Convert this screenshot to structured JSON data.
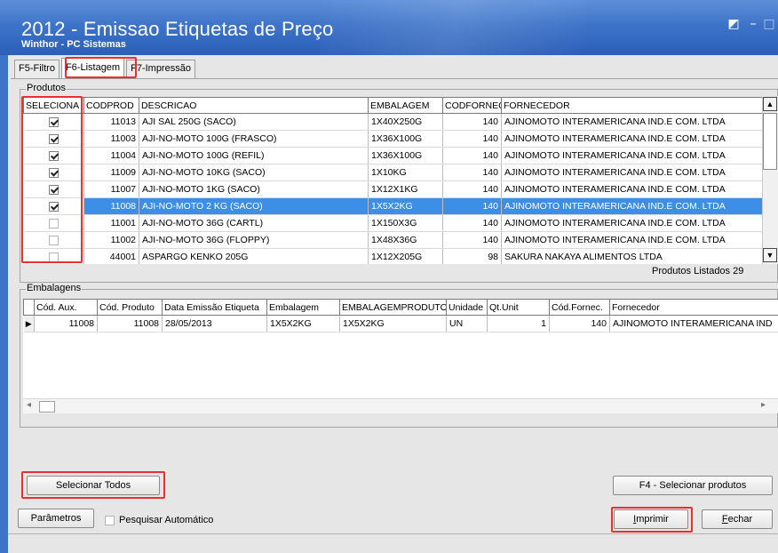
{
  "window": {
    "title": "2012 - Emissao Etiquetas de Preço",
    "subtitle": "Winthor - PC Sistemas"
  },
  "tabs": [
    {
      "label": "F5-Filtro"
    },
    {
      "label": "F6-Listagem"
    },
    {
      "label": "F7-Impressão"
    }
  ],
  "produtos": {
    "group_label": "Produtos",
    "columns": [
      "SELECIONA",
      "CODPROD",
      "DESCRICAO",
      "EMBALAGEM",
      "CODFORNEC",
      "FORNECEDOR"
    ],
    "rows": [
      {
        "checked": true,
        "codprod": "11013",
        "descricao": "AJI SAL 250G (SACO)",
        "embalagem": "1X40X250G",
        "codfornec": "140",
        "fornecedor": "AJINOMOTO INTERAMERICANA IND.E COM. LTDA"
      },
      {
        "checked": true,
        "codprod": "11003",
        "descricao": "AJI-NO-MOTO 100G (FRASCO)",
        "embalagem": "1X36X100G",
        "codfornec": "140",
        "fornecedor": "AJINOMOTO INTERAMERICANA IND.E COM. LTDA"
      },
      {
        "checked": true,
        "codprod": "11004",
        "descricao": "AJI-NO-MOTO 100G (REFIL)",
        "embalagem": "1X36X100G",
        "codfornec": "140",
        "fornecedor": "AJINOMOTO INTERAMERICANA IND.E COM. LTDA"
      },
      {
        "checked": true,
        "codprod": "11009",
        "descricao": "AJI-NO-MOTO 10KG (SACO)",
        "embalagem": "1X10KG",
        "codfornec": "140",
        "fornecedor": "AJINOMOTO INTERAMERICANA IND.E COM. LTDA"
      },
      {
        "checked": true,
        "codprod": "11007",
        "descricao": "AJI-NO-MOTO 1KG (SACO)",
        "embalagem": "1X12X1KG",
        "codfornec": "140",
        "fornecedor": "AJINOMOTO INTERAMERICANA IND.E COM. LTDA"
      },
      {
        "checked": true,
        "codprod": "11008",
        "descricao": "AJI-NO-MOTO 2 KG (SACO)",
        "embalagem": "1X5X2KG",
        "codfornec": "140",
        "fornecedor": "AJINOMOTO INTERAMERICANA IND.E COM. LTDA",
        "selected": true
      },
      {
        "checked": false,
        "codprod": "11001",
        "descricao": "AJI-NO-MOTO 36G (CARTL)",
        "embalagem": "1X150X3G",
        "codfornec": "140",
        "fornecedor": "AJINOMOTO INTERAMERICANA IND.E COM. LTDA"
      },
      {
        "checked": false,
        "codprod": "11002",
        "descricao": "AJI-NO-MOTO 36G (FLOPPY)",
        "embalagem": "1X48X36G",
        "codfornec": "140",
        "fornecedor": "AJINOMOTO INTERAMERICANA IND.E COM. LTDA"
      },
      {
        "checked": false,
        "codprod": "44001",
        "descricao": "ASPARGO KENKO 205G",
        "embalagem": "1X12X205G",
        "codfornec": "98",
        "fornecedor": "SAKURA NAKAYA ALIMENTOS LTDA"
      }
    ],
    "status": "Produtos Listados 29"
  },
  "embalagens": {
    "group_label": "Embalagens",
    "columns": [
      "Cód. Aux.",
      "Cód. Produto",
      "Data Emissão Etiqueta",
      "Embalagem",
      "EMBALAGEMPRODUTO",
      "Unidade",
      "Qt.Unit",
      "Cód.Fornec.",
      "Fornecedor"
    ],
    "rows": [
      {
        "cod_aux": "11008",
        "cod_produto": "11008",
        "data_emissao": "28/05/2013",
        "embalagem": "1X5X2KG",
        "embalagemproduto": "1X5X2KG",
        "unidade": "UN",
        "qt_unit": "1",
        "cod_fornec": "140",
        "fornecedor": "AJINOMOTO INTERAMERICANA IND"
      }
    ]
  },
  "buttons": {
    "selecionar_todos": "Selecionar Todos",
    "f4_selecionar": "F4 - Selecionar produtos",
    "parametros": "Parâmetros",
    "imprimir_first": "I",
    "imprimir_rest": "mprimir",
    "fechar_first": "F",
    "fechar_rest": "echar"
  },
  "pesquisar_automatico": {
    "label": "Pesquisar Automático",
    "checked": false
  },
  "colors": {
    "titlebar": "#3e74c8",
    "selection": "#3d8ee6",
    "highlight": "#e83030"
  }
}
